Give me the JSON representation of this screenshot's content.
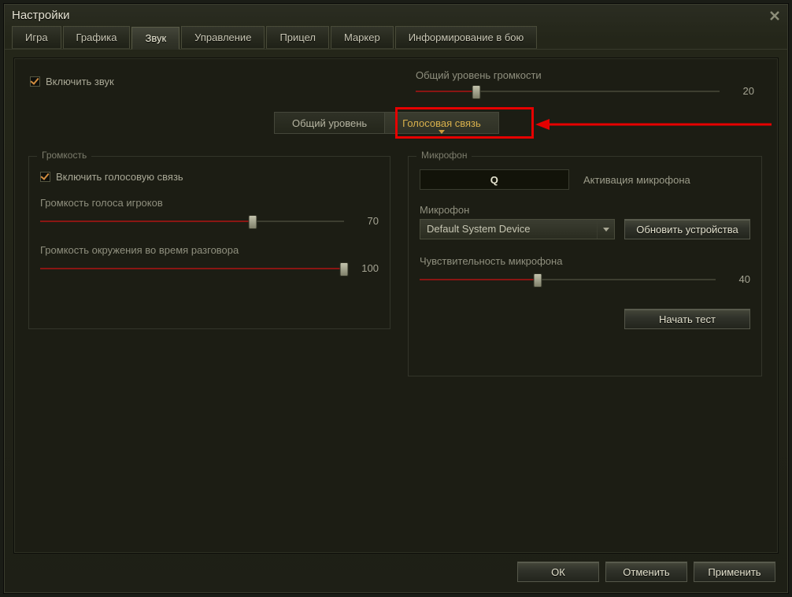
{
  "window": {
    "title": "Настройки"
  },
  "tabs": [
    {
      "label": "Игра"
    },
    {
      "label": "Графика"
    },
    {
      "label": "Звук"
    },
    {
      "label": "Управление"
    },
    {
      "label": "Прицел"
    },
    {
      "label": "Маркер"
    },
    {
      "label": "Информирование в бою"
    }
  ],
  "activeTab": 2,
  "enableSound": {
    "label": "Включить звук",
    "checked": true
  },
  "masterVolume": {
    "label": "Общий уровень громкости",
    "value": 20
  },
  "subtabs": {
    "general": "Общий уровень",
    "voice": "Голосовая связь"
  },
  "volumeSection": {
    "legend": "Громкость",
    "enableVoice": {
      "label": "Включить голосовую связь",
      "checked": true
    },
    "playerVolume": {
      "label": "Громкость голоса игроков",
      "value": 70
    },
    "ambientVolume": {
      "label": "Громкость окружения во время разговора",
      "value": 100
    }
  },
  "micSection": {
    "legend": "Микрофон",
    "pttKey": "Q",
    "pttLabel": "Активация микрофона",
    "deviceLabel": "Микрофон",
    "device": "Default System Device",
    "refresh": "Обновить устройства",
    "sensitivity": {
      "label": "Чувствительность микрофона",
      "value": 40
    },
    "startTest": "Начать тест"
  },
  "footer": {
    "ok": "ОК",
    "cancel": "Отменить",
    "apply": "Применить"
  }
}
